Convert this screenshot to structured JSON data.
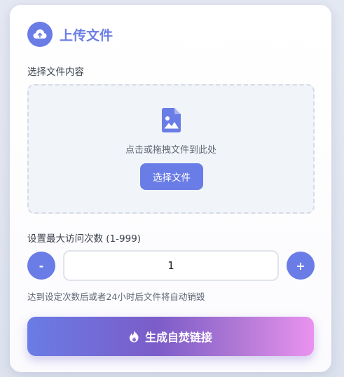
{
  "title": "上传文件",
  "file_section": {
    "label": "选择文件内容",
    "drop_hint": "点击或拖拽文件到此处",
    "choose_button": "选择文件"
  },
  "visits": {
    "label": "设置最大访问次数 (1-999)",
    "minus": "-",
    "plus": "+",
    "value": "1",
    "note": "达到设定次数后或者24小时后文件将自动销毁"
  },
  "generate_button": "生成自焚链接",
  "icons": {
    "title": "cloud-upload-icon",
    "file": "file-image-icon",
    "generate": "fire-icon"
  },
  "colors": {
    "accent": "#6a7ce6",
    "gradient_start": "#6a7ce6",
    "gradient_end": "#eb92f0"
  }
}
